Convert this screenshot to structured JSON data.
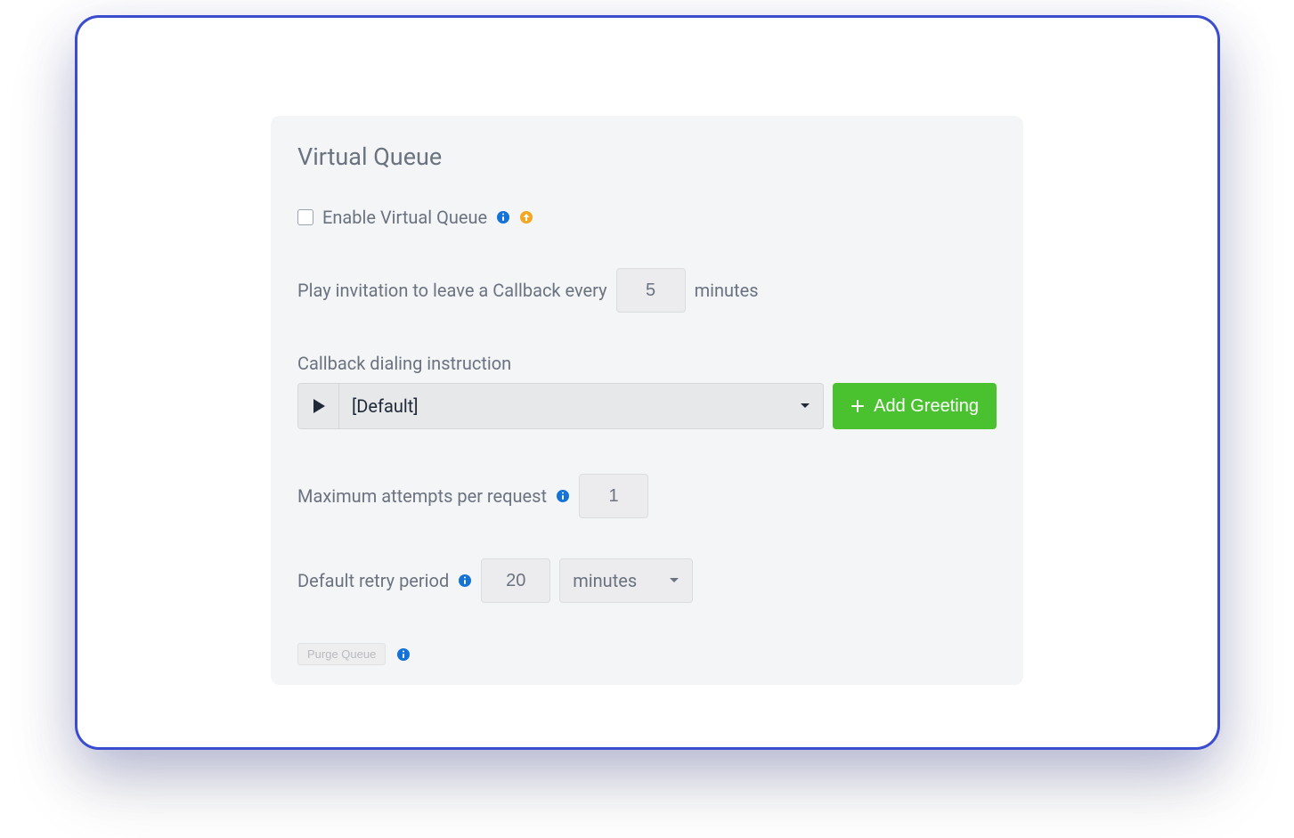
{
  "card": {
    "title": "Virtual Queue",
    "enable": {
      "label": "Enable Virtual Queue",
      "checked": false
    },
    "invitation": {
      "prefix": "Play invitation to leave a Callback every",
      "value": "5",
      "suffix": "minutes"
    },
    "dialing": {
      "label": "Callback dialing instruction",
      "selected": "[Default]",
      "addButton": "Add Greeting"
    },
    "maxAttempts": {
      "label": "Maximum attempts per request",
      "value": "1"
    },
    "retry": {
      "label": "Default retry period",
      "value": "20",
      "unit": "minutes"
    },
    "purge": {
      "label": "Purge Queue"
    }
  }
}
